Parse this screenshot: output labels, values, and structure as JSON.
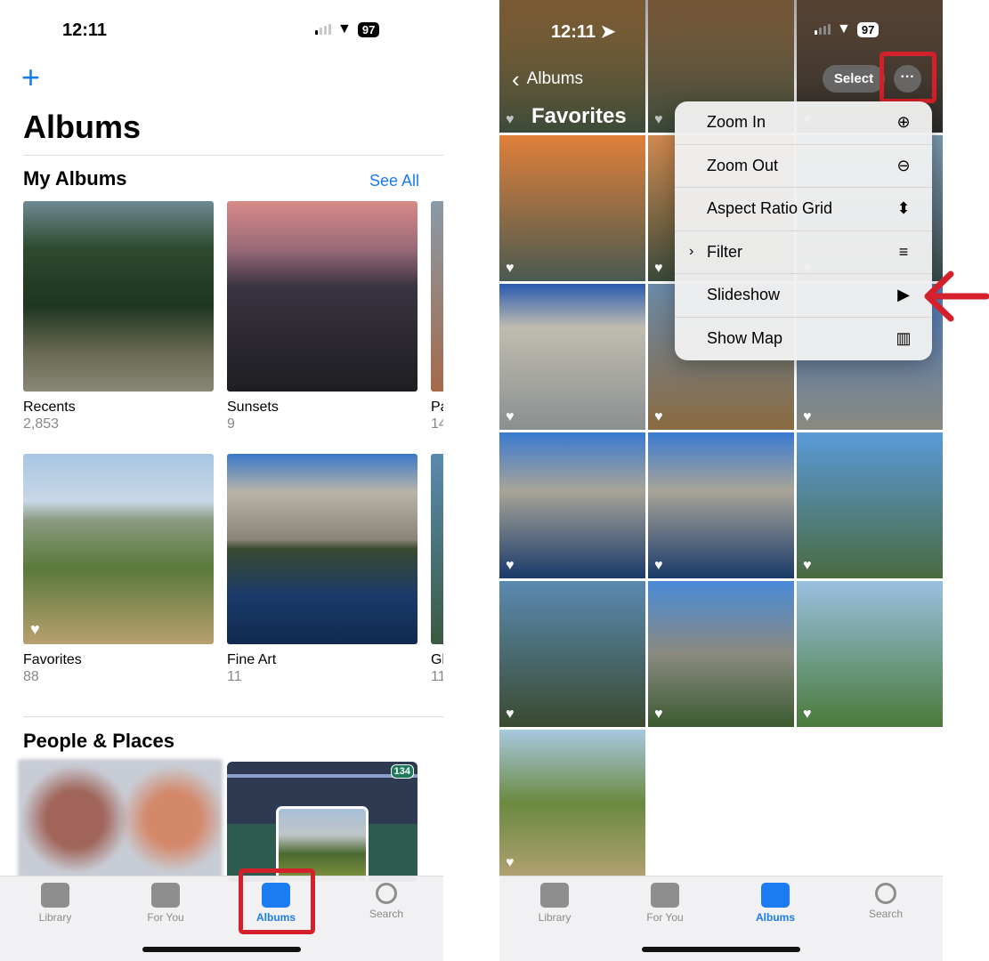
{
  "left": {
    "status": {
      "time": "12:11",
      "battery": "97"
    },
    "add_icon": "plus-icon",
    "title": "Albums",
    "my_albums": {
      "heading": "My Albums",
      "see_all": "See All",
      "albums": [
        {
          "name": "Recents",
          "count": "2,853"
        },
        {
          "name": "Sunsets",
          "count": "9"
        },
        {
          "name": "Pa",
          "count": "14"
        },
        {
          "name": "Favorites",
          "count": "88"
        },
        {
          "name": "Fine Art",
          "count": "11"
        },
        {
          "name": "Gl",
          "count": "11"
        }
      ]
    },
    "people_places": {
      "heading": "People & Places",
      "map_badge": "134"
    }
  },
  "right": {
    "status": {
      "time": "12:11",
      "battery": "97"
    },
    "back_label": "Albums",
    "title": "Favorites",
    "select_label": "Select",
    "more_icon": "ellipsis-icon",
    "menu": [
      {
        "label": "Zoom In",
        "icon": "zoom-in-icon"
      },
      {
        "label": "Zoom Out",
        "icon": "zoom-out-icon"
      },
      {
        "label": "Aspect Ratio Grid",
        "icon": "aspect-ratio-icon"
      },
      {
        "label": "Filter",
        "icon": "filter-icon",
        "submenu": true
      },
      {
        "label": "Slideshow",
        "icon": "play-icon"
      },
      {
        "label": "Show Map",
        "icon": "map-icon"
      }
    ]
  },
  "tabs": [
    {
      "label": "Library",
      "icon": "photo-library-icon"
    },
    {
      "label": "For You",
      "icon": "for-you-icon"
    },
    {
      "label": "Albums",
      "icon": "albums-icon",
      "active": true
    },
    {
      "label": "Search",
      "icon": "search-icon"
    }
  ],
  "highlight_color": "#d4202a",
  "accent_color": "#1a7cf0"
}
